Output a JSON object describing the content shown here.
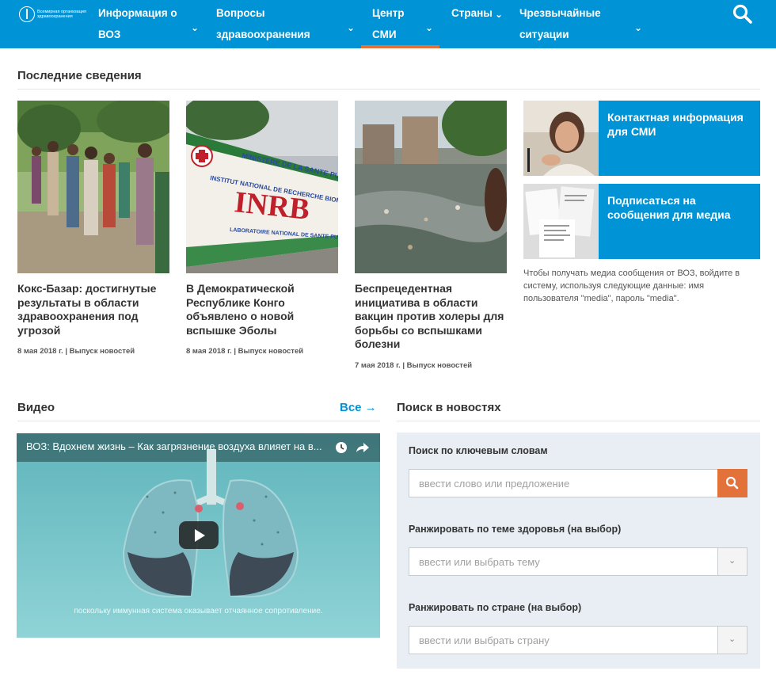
{
  "header": {
    "logo_text": "Всемирная организация здравоохранения",
    "nav": [
      {
        "label": "Информация о ВОЗ"
      },
      {
        "label": "Вопросы здравоохранения"
      },
      {
        "label": "Центр СМИ"
      },
      {
        "label": "Страны"
      },
      {
        "label": "Чрезвычайные ситуации"
      }
    ],
    "active_nav": "Центр СМИ",
    "search_icon": "search-icon",
    "colors": {
      "bar": "#0093d5",
      "accent": "#e3713a"
    }
  },
  "latest": {
    "title": "Последние сведения",
    "items": [
      {
        "title": "Кокс-Базар: достигнутые результаты в области здравоохранения под угрозой",
        "meta": "8 мая 2018 г. | Выпуск новостей"
      },
      {
        "title": "В Демократической Республике Конго объявлено о новой вспышке Эболы",
        "meta": "8 мая 2018 г. | Выпуск новостей",
        "sign_main": "INRB",
        "sign_top": "INSTITUT NATIONAL DE RECHERCHE BIOMEDICALE",
        "sign_bottom": "LABORATOIRE NATIONAL DE SANTE PUBLIQUE",
        "sign_ministry": "MINISTERE DE LA SANTE PUBLIQUE"
      },
      {
        "title": "Беспрецедентная инициатива в области вакцин против холеры для борьбы со вспышками болезни",
        "meta": "7 мая 2018 г. | Выпуск новостей"
      }
    ]
  },
  "media": {
    "contact_label": "Контактная информация для СМИ",
    "subscribe_label": "Подписаться на сообщения для медиа",
    "note": "Чтобы получать медиа сообщения от ВОЗ, войдите в систему, используя следующие данные: имя пользователя \"media\", пароль \"media\"."
  },
  "video": {
    "section_title": "Видео",
    "all_link": "Все →",
    "title": "ВОЗ: Вдохнем жизнь – Как загрязнение воздуха влияет на в...",
    "caption": "поскольку иммунная система оказывает отчаянное сопротивление."
  },
  "search": {
    "section_title": "Поиск в новостях",
    "keyword_label": "Поиск по ключевым словам",
    "keyword_placeholder": "ввести слово или предложение",
    "topic_label": "Ранжировать по теме здоровья (на выбор)",
    "topic_placeholder": "ввести или выбрать тему",
    "country_label": "Ранжировать по стране (на выбор)",
    "country_placeholder": "ввести или выбрать страну"
  }
}
